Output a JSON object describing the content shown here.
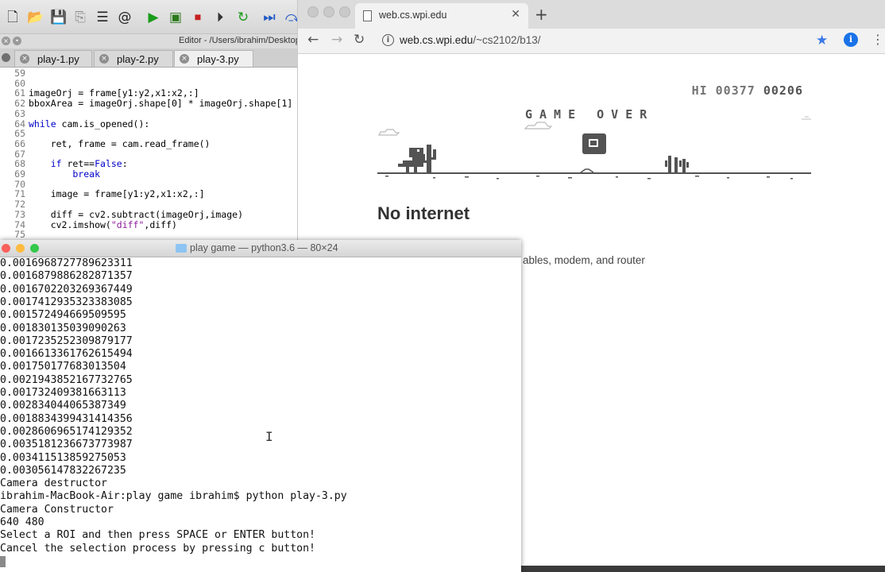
{
  "editor": {
    "title": "Editor - /Users/ibrahim/Desktop/c",
    "tabs": [
      {
        "label": "play-1.py"
      },
      {
        "label": "play-2.py"
      },
      {
        "label": "play-3.py"
      }
    ],
    "lines": [
      {
        "n": "59",
        "code": ""
      },
      {
        "n": "60",
        "code": ""
      },
      {
        "n": "61",
        "code": "imageOrj = frame[y1:y2,x1:x2,:]"
      },
      {
        "n": "62",
        "code": "bboxArea = imageOrj.shape[0] * imageOrj.shape[1]"
      },
      {
        "n": "63",
        "code": ""
      },
      {
        "n": "64",
        "kw": "while",
        "code": " cam.is_opened():"
      },
      {
        "n": "65",
        "code": ""
      },
      {
        "n": "66",
        "code": "    ret, frame = cam.read_frame()"
      },
      {
        "n": "67",
        "code": ""
      },
      {
        "n": "68",
        "kw": "    if",
        "code": " ret==",
        "kw2": "False",
        "code2": ":"
      },
      {
        "n": "69",
        "kw": "        break",
        "code": ""
      },
      {
        "n": "70",
        "code": ""
      },
      {
        "n": "71",
        "code": "    image = frame[y1:y2,x1:x2,:]"
      },
      {
        "n": "72",
        "code": ""
      },
      {
        "n": "73",
        "code": "    diff = cv2.subtract(imageOrj,image)"
      },
      {
        "n": "74",
        "code": "    cv2.imshow(",
        "str": "\"diff\"",
        "code2": ",diff)"
      },
      {
        "n": "75",
        "code": ""
      }
    ]
  },
  "browser": {
    "tab_title": "web.cs.wpi.edu",
    "url_host": "web.cs.wpi.edu",
    "url_path": "/~cs2102/b13/",
    "hi_label": "HI",
    "hi_score": "00377",
    "score": "00206",
    "game_over": "GAME OVER",
    "no_internet": "No internet",
    "tip_fragment": "ables, modem, and router",
    "ext_letter": "i"
  },
  "terminal": {
    "title": "play game — python3.6 — 80×24",
    "lines": [
      "0.0016968727789623311",
      "0.0016879886282871357",
      "0.0016702203269367449",
      "0.0017412935323383085",
      "0.001572494669509595",
      "0.001830135039090263",
      "0.0017235252309879177",
      "0.0016613361762615494",
      "0.001750177683013504",
      "0.0021943852167732765",
      "0.001732409381663113",
      "0.002834044065387349",
      "0.0018834399431414356",
      "0.0028606965174129352",
      "0.0035181236673773987",
      "0.003411513859275053",
      "0.003056147832267235",
      "Camera destructor",
      "ibrahim-MacBook-Air:play game ibrahim$ python play-3.py",
      "Camera Constructor",
      "640 480",
      "Select a ROI and then press SPACE or ENTER button!",
      "Cancel the selection process by pressing c button!"
    ]
  },
  "colors": {
    "game_gray": "#535353",
    "term_close": "#fc605b",
    "term_min": "#fdbc40",
    "term_max": "#34c84a"
  }
}
